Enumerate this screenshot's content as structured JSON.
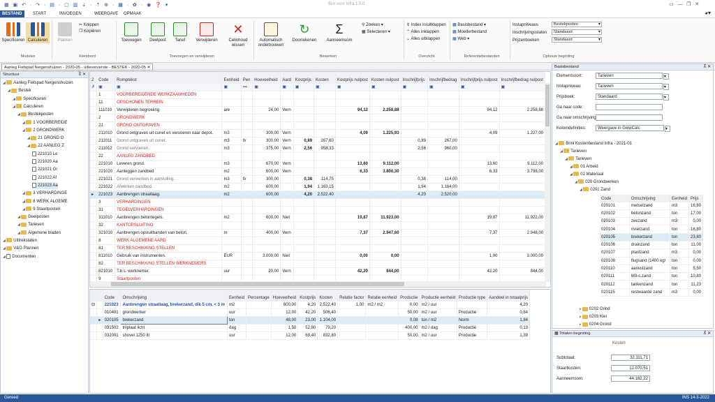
{
  "app": {
    "title": "Bim voor Infra 1.5.0"
  },
  "menu": [
    "BESTAND",
    "START",
    "INVOEGEN",
    "WEERGAVE",
    "OPMAAK"
  ],
  "ribbon": {
    "modules": {
      "label": "Modules",
      "items": [
        "Specificeren",
        "Calculeren"
      ]
    },
    "klembord": {
      "label": "Klembord",
      "plakken": "Plakken",
      "knippen": "Knippen",
      "kopieren": "Kopiëren"
    },
    "toevoegen": {
      "label": "Toevoegen en verwijderen",
      "items": [
        "Toevoegen",
        "Deelpost",
        "Tarief",
        "Verwijderen",
        "Celinhoud wissen"
      ]
    },
    "bewerken": {
      "label": "Bewerken",
      "items": [
        "Automatisch onderbouwen",
        "Doorrekenen",
        "Aanneemsom"
      ],
      "zoeken": "Zoeken",
      "selecteren": "Selecteren"
    },
    "overzicht": {
      "label": "Overzicht",
      "items": [
        "Index in/uitklappen",
        "Alles inklappen",
        "Alles uitklappen"
      ]
    },
    "referentie": {
      "label": "Referentiebestanden",
      "items": [
        "Basisbestand",
        "Moederbestand",
        "Web"
      ]
    },
    "opbouw": {
      "label": "Opbouw begroting",
      "rows": [
        [
          "Instapniveaus",
          "Bestekposten"
        ],
        [
          "Inschrijvingsstaten",
          "Standaard"
        ],
        [
          "Prijzenboeken",
          "Standaard"
        ]
      ]
    }
  },
  "doctab": "Aanleg Fietspad Nergenshuizen - 2020-05 - uitleververste - BESTEK - 2020-05",
  "structuur": {
    "title": "Structuur",
    "items": [
      {
        "t": "Aanleg Fietspad Nergenshuizen",
        "lvl": 0,
        "i": "f"
      },
      {
        "t": "Bestek",
        "lvl": 1,
        "i": "f"
      },
      {
        "t": "Specificeren",
        "lvl": 2,
        "i": "f"
      },
      {
        "t": "Calculeren",
        "lvl": 2,
        "i": "f"
      },
      {
        "t": "Bestekposten",
        "lvl": 3,
        "i": "f"
      },
      {
        "t": "1 VOORBEREIDE",
        "lvl": 4,
        "i": "f"
      },
      {
        "t": "2 GRONDWERK",
        "lvl": 4,
        "i": "f"
      },
      {
        "t": "21 GROND O",
        "lvl": 5,
        "i": "f"
      },
      {
        "t": "22 AANLEG Z",
        "lvl": 5,
        "i": "f"
      },
      {
        "t": "221010 Le",
        "lvl": 6,
        "i": "d"
      },
      {
        "t": "221020 Aa",
        "lvl": 6,
        "i": "d"
      },
      {
        "t": "221021 Gr",
        "lvl": 6,
        "i": "d"
      },
      {
        "t": "221022 Af",
        "lvl": 6,
        "i": "d"
      },
      {
        "t": "221023 Aa",
        "lvl": 6,
        "i": "d"
      },
      {
        "t": "3 VERHARDINGE",
        "lvl": 4,
        "i": "f"
      },
      {
        "t": "8 WERK ALGEME",
        "lvl": 4,
        "i": "f"
      },
      {
        "t": "9 Staartposten",
        "lvl": 4,
        "i": "f"
      },
      {
        "t": "Deelposten",
        "lvl": 3,
        "i": "f"
      },
      {
        "t": "Tarieven",
        "lvl": 3,
        "i": "f"
      },
      {
        "t": "Algemene bladen",
        "lvl": 3,
        "i": "f"
      },
      {
        "t": "Uittrekstaten",
        "lvl": 0,
        "i": "f"
      },
      {
        "t": "V&G Plannen",
        "lvl": 0,
        "i": "f"
      },
      {
        "t": "Documenten",
        "lvl": 0,
        "i": "d"
      }
    ]
  },
  "maingrid": {
    "headers": [
      "2",
      "Code",
      "Romptekst",
      "Eenheid",
      "Pen",
      "Hoeveelheid",
      "Aard",
      "Kostprijs",
      "Kosten",
      "Kostprijs nulpost",
      "Kosten nulpost",
      "Inschrijfprijs",
      "Inschrijfbedrag",
      "Inschrijfprijs nulpost",
      "Inschrijfbedrag nulpost"
    ],
    "rows": [
      {
        "c": "1",
        "r": "VOORBEREIDENDE WERKZAAMHEDEN",
        "s": "red"
      },
      {
        "c": "11",
        "r": "OPSCHONEN TERREIN",
        "s": "red"
      },
      {
        "c": "111010",
        "r": "Verwijderen begroeiing",
        "e": "are",
        "h": "24,00",
        "a": "Vern",
        "kn": "94,12",
        "kon": "2.258,88",
        "ipn": "94,12",
        "ibn": "2.258,88"
      },
      {
        "c": "2",
        "r": "GRONDWERK",
        "s": "red"
      },
      {
        "c": "21",
        "r": "GROND ONTGRAVEN",
        "s": "red"
      },
      {
        "c": "211010",
        "r": "Grond ontgraven uit cunet en vervoeren naar depot.",
        "e": "m3",
        "h": "300,00",
        "a": "Vern",
        "kn": "4,09",
        "kon": "1.225,93",
        "ipn": "4,09",
        "ibn": "1.227,00"
      },
      {
        "c": "211011",
        "r": "Grond ontgraven uit cunet.",
        "e": "m3",
        "f": "fx",
        "h": "300,00",
        "a": "Vern",
        "kp": "0,89",
        "ko": "267,60",
        "ip": "0,89",
        "ib": "267,00",
        "s": "grey"
      },
      {
        "c": "211012",
        "r": "Grond vervoeren.",
        "e": "m3",
        "h": "375,00",
        "a": "Vern",
        "kp": "2,56",
        "ko": "958,33",
        "ip": "2,56",
        "ib": "960,00",
        "s": "grey"
      },
      {
        "c": "22",
        "r": "AANLEG ZANDBED",
        "s": "red"
      },
      {
        "c": "221010",
        "r": "Leveren grond.",
        "e": "m3",
        "h": "670,00",
        "a": "Vern",
        "kn": "13,60",
        "kon": "9.112,00",
        "ipn": "13,60",
        "ibn": "9.112,00"
      },
      {
        "c": "221020",
        "r": "Aanleggen zandbed",
        "e": "m2",
        "h": "600,00",
        "a": "Vern",
        "kn": "6,33",
        "kon": "3.800,30",
        "ipn": "6,33",
        "ibn": "3.798,00"
      },
      {
        "c": "221021",
        "r": "Grond verwerken in aanvulling.",
        "e": "m3",
        "f": "fx",
        "h": "300,00",
        "kp": "0,38",
        "ko": "114,75",
        "ip": "0,38",
        "ib": "114,00",
        "s": "grey"
      },
      {
        "c": "221022",
        "r": "Afwerken zandbed.",
        "e": "m2",
        "h": "600,00",
        "kp": "1,94",
        "ko": "1.163,15",
        "ip": "1,94",
        "ib": "1.164,00",
        "s": "grey"
      },
      {
        "c": "221023",
        "r": "Aanbrengen straatlaag.",
        "e": "m2",
        "h": "600,00",
        "kp": "4,20",
        "ko": "2.522,40",
        "ip": "4,20",
        "ib": "2.520,00",
        "sel": true
      },
      {
        "c": "3",
        "r": "VERHARDINGEN",
        "s": "red"
      },
      {
        "c": "31",
        "r": "TEGELVERHARDINGEN",
        "s": "red"
      },
      {
        "c": "311010",
        "r": "Aanbrengen betontegels.",
        "e": "m2",
        "h": "600,00",
        "a": "Niet",
        "kn": "19,87",
        "kon": "11.923,00",
        "ipn": "19,87",
        "ibn": "11.922,00"
      },
      {
        "c": "32",
        "r": "KANTOPSLUITING",
        "s": "red"
      },
      {
        "c": "321010",
        "r": "Aanbrengen opsluitbanden van beton.",
        "e": "m",
        "h": "400,00",
        "a": "Vern",
        "kn": "7,37",
        "kon": "2.947,60",
        "ipn": "7,37",
        "ibn": "2.948,00"
      },
      {
        "c": "8",
        "r": "WERK ALGEMENE AARD",
        "s": "red"
      },
      {
        "c": "81",
        "r": "TER BESCHIKKING STELLEN",
        "s": "red"
      },
      {
        "c": "811010",
        "r": "Gebruik van instrumenten.",
        "e": "EUR",
        "h": "3.000,00",
        "a": "Niet",
        "kn": "0,00",
        "kon": "0,00",
        "ipn": "1,00",
        "ibn": "3.000,00"
      },
      {
        "c": "82",
        "r": "TER BESCHIKKING STELLEN WERKNEMERS",
        "s": "red"
      },
      {
        "c": "821010",
        "r": "T.b.s. werknemer.",
        "e": "uur",
        "h": "20,00",
        "a": "Vern",
        "kn": "42,20",
        "kon": "844,00",
        "ipn": "42,20",
        "ibn": "844,00"
      },
      {
        "c": "9",
        "r": "Staartposten",
        "s": "red"
      }
    ]
  },
  "subgrid": {
    "headers": [
      "Code",
      "Omschrijving",
      "Eenheid",
      "Percentage",
      "Hoeveelheid",
      "Kostprijs",
      "Kosten",
      "Relatie factor",
      "Relatie eenheid",
      "Productie",
      "Productie eenheid",
      "Productie type",
      "Aandeel in totaalprijs"
    ],
    "rows": [
      {
        "c": "221023",
        "o": "Aanbrengen straatlaag, brekerzand, dik 5 cm, < 3 m",
        "e": "m2",
        "h": "600,00",
        "kp": "4,20",
        "k": "2.522,40",
        "rf": "1,00",
        "re": "m2 / m2",
        "p": "0,00",
        "pe": "m2 / uur",
        "pt": "",
        "a": "4,20",
        "head": true
      },
      {
        "c": "010401",
        "o": "grondwerker",
        "e": "uur",
        "h": "12,00",
        "kp": "42,20",
        "k": "506,40",
        "rf": "",
        "re": "",
        "p": "50,00",
        "pe": "m2 / uur",
        "pt": "Productie",
        "a": "0,84"
      },
      {
        "c": "020105",
        "o": "brekerzand",
        "e": "ton",
        "h": "48,00",
        "kp": "23,00",
        "k": "1.104,00",
        "rf": "",
        "re": "",
        "p": "0,08",
        "pe": "ton / m2",
        "pt": "Norm",
        "a": "1,84",
        "sel": true
      },
      {
        "c": "031502",
        "o": "trilplaat licht",
        "e": "dag",
        "h": "1,50",
        "kp": "52,80",
        "k": "79,20",
        "rf": "",
        "re": "",
        "p": "400,00",
        "pe": "m2 / dag",
        "pt": "Productie",
        "a": "0,13"
      },
      {
        "c": "032001",
        "o": "shovel 1250 ltr",
        "e": "uur",
        "h": "12,00",
        "kp": "69,40",
        "k": "832,80",
        "rf": "",
        "re": "",
        "p": "50,00",
        "pe": "m2 / uur",
        "pt": "Productie",
        "a": "1,39"
      }
    ]
  },
  "basis": {
    "title": "Basisbestand",
    "fields": [
      [
        "Elementsoort:",
        "Tarieven"
      ],
      [
        "Instapniveau:",
        "Tarieven"
      ],
      [
        "Prijsboek:",
        "Standaard"
      ],
      [
        "Ga naar code:",
        ""
      ],
      [
        "Ga naar omschrijving:",
        ""
      ],
      [
        "Kolomdefinities:",
        "Weergave in GwwCalc"
      ]
    ],
    "tree": [
      {
        "t": "Brinl Kostenbestand Infra - 2021-01",
        "lvl": 0
      },
      {
        "t": "Tarieven",
        "lvl": 1
      },
      {
        "t": "Tarieven",
        "lvl": 2
      },
      {
        "t": "01 Arbeid",
        "lvl": 3
      },
      {
        "t": "02 Materiaal",
        "lvl": 3
      },
      {
        "t": "020 Grondwerken",
        "lvl": 4
      },
      {
        "t": "0201 Zand",
        "lvl": 5
      }
    ],
    "table_headers": [
      "Code",
      "Omschrijving",
      "Eenheid",
      "Prijs"
    ],
    "table": [
      [
        "020101",
        "metselzand",
        "m3",
        "16,80"
      ],
      [
        "020102",
        "betonzand",
        "ton",
        "17,00"
      ],
      [
        "020103",
        "zeezand",
        "m3",
        "0,00"
      ],
      [
        "020104",
        "rivierzand",
        "ton",
        "16,80"
      ],
      [
        "020105",
        "brekerzand",
        "ton",
        "23,80"
      ],
      [
        "020106",
        "drainzand",
        "ton",
        "11,00"
      ],
      [
        "020107",
        "plastzand",
        "m3",
        "0,00"
      ],
      [
        "020108",
        "flugsand (1400 kg/",
        "ton",
        "0,00"
      ],
      [
        "020110",
        "aanvulzand",
        "ton",
        "5,50"
      ],
      [
        "020111",
        "M3-c.zand",
        "ton",
        "10,80"
      ],
      [
        "020112",
        "tankenzand",
        "ton",
        "11,23"
      ],
      [
        "020115",
        "restwaarde zand",
        "m3",
        "0,00"
      ]
    ],
    "tree2": [
      {
        "t": "0202 Grind",
        "lvl": 5
      },
      {
        "t": "0203 Klei",
        "lvl": 5
      },
      {
        "t": "0204 Grond",
        "lvl": 5
      },
      {
        "t": "0205 Funderingsmaterialen",
        "lvl": 5
      }
    ]
  },
  "totals": {
    "title": "Totalen begroting",
    "col": "Kosten",
    "rows": [
      [
        "Subtotaal:",
        "32.111,71"
      ],
      [
        "Staartkosten:",
        "12.070,51"
      ],
      [
        "Aanneemsom:",
        "44.182,22"
      ]
    ]
  },
  "status": {
    "left": "Gereed",
    "right": "INS  14-3-2022"
  }
}
